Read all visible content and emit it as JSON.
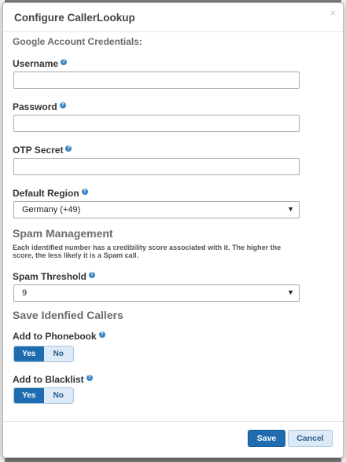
{
  "dialog": {
    "title": "Configure CallerLookup",
    "close_glyph": "×"
  },
  "credentials": {
    "section_label": "Google Account Credentials:",
    "username": {
      "label": "Username",
      "value": "",
      "placeholder": ""
    },
    "password": {
      "label": "Password",
      "value": "",
      "placeholder": ""
    },
    "otp_secret": {
      "label": "OTP Secret",
      "value": "",
      "placeholder": ""
    },
    "default_region": {
      "label": "Default Region",
      "selected": "Germany (+49)"
    }
  },
  "spam": {
    "heading": "Spam Management",
    "description": "Each identified number has a credibility score associated with it. The higher the score, the less likely it is a Spam call.",
    "threshold": {
      "label": "Spam Threshold",
      "selected": "9"
    }
  },
  "save_callers": {
    "heading": "Save Idenfied Callers",
    "phonebook": {
      "label": "Add to Phonebook",
      "yes": "Yes",
      "no": "No",
      "value": "Yes"
    },
    "blacklist": {
      "label": "Add to Blacklist",
      "yes": "Yes",
      "no": "No",
      "value": "Yes"
    }
  },
  "footer": {
    "save_label": "Save",
    "cancel_label": "Cancel"
  },
  "icons": {
    "help": "question-circle-icon",
    "dropdown": "caret-down-icon"
  },
  "colors": {
    "primary": "#1f6cb0",
    "secondary": "#dbeaf6",
    "help_icon": "#3a86c8"
  }
}
